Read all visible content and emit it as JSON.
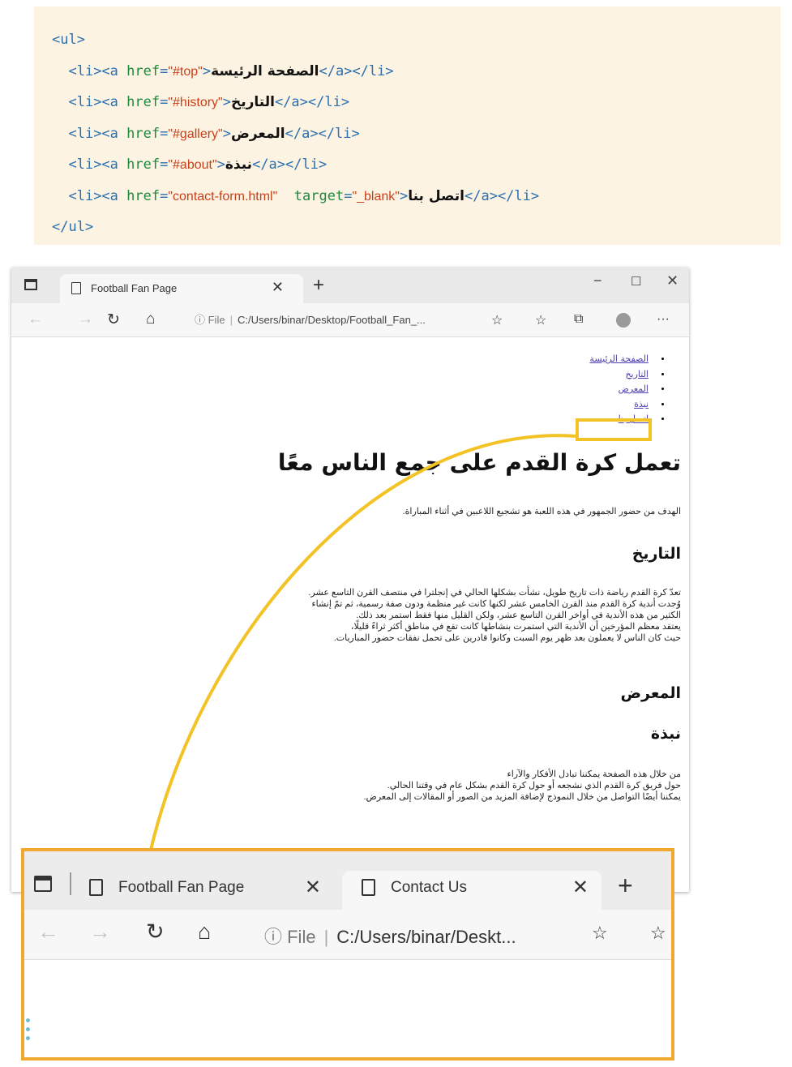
{
  "code": {
    "open_ul": "<ul>",
    "close_ul": "</ul>",
    "items": [
      {
        "href": "\"#top\"",
        "text": "الصفحة الرئيسة",
        "target": ""
      },
      {
        "href": "\"#history\"",
        "text": "التاريخ",
        "target": ""
      },
      {
        "href": "\"#gallery\"",
        "text": "المعرض",
        "target": ""
      },
      {
        "href": "\"#about\"",
        "text": "نبذة",
        "target": ""
      },
      {
        "href": "\"contact-form.html\"",
        "text": "اتصل بنا",
        "target": "\"_blank\""
      }
    ]
  },
  "browser": {
    "tab_title": "Football Fan Page",
    "address_info": "ⓘ File",
    "address_path": "C:/Users/binar/Desktop/Football_Fan_...",
    "content": {
      "nav": [
        "الصفحة الرئيسة",
        "التاريخ",
        "المعرض",
        "نبذة",
        "اتصل بنا"
      ],
      "heading": "تعمل كرة القدم على جمع الناس معًا",
      "lead": "الهدف من حضور الجمهور في هذه اللعبة هو تشجيع اللاعبين في أثناء المباراة.",
      "history_heading": "التاريخ",
      "history_paragraph": [
        "تعدّ كرة القدم رياضة ذات تاريخ طويل، نشأت بشكلها الحالي في إنجلترا في منتصف القرن التاسع عشر.",
        "وُجدت أندية كرة القدم منذ القرن الخامس عشر لكنها كانت غير منظمة ودون صفة رسمية، ثم تمّ إنشاء",
        "الكثير من هذه الأندية في أواخر القرن التاسع عشر، ولكن القليل منها فقط استمر بعد ذلك.",
        "يعتقد معظم المؤرخين أن الأندية التي استمرت بنشاطها كانت تقع في مناطق أكثر ثراءً قليلًا،",
        "حيث كان الناس لا يعملون بعد ظهر يوم السبت وكانوا قادرين على تحمل نفقات حضور المباريات."
      ],
      "gallery_heading": "المعرض",
      "about_heading": "نبذة",
      "about_paragraph": [
        "من خلال هذه الصفحة يمكننا تبادل الأفكار والآراء",
        "حول فريق كرة القدم الذي نشجعه أو حول كرة القدم بشكل عام في وقتنا الحالي.",
        "يمكننا أيضًا التواصل من خلال النموذج لإضافة المزيد من الصور أو المقالات إلى المعرض."
      ]
    }
  },
  "zoom": {
    "tab1_title": "Football Fan Page",
    "tab2_title": "Contact Us",
    "address_info": "ⓘ File",
    "address_path": "C:/Users/binar/Deskt..."
  },
  "colors": {
    "highlight": "#f3c326",
    "zoom_border": "#f0a830",
    "code_bg": "#fdf3e2"
  }
}
